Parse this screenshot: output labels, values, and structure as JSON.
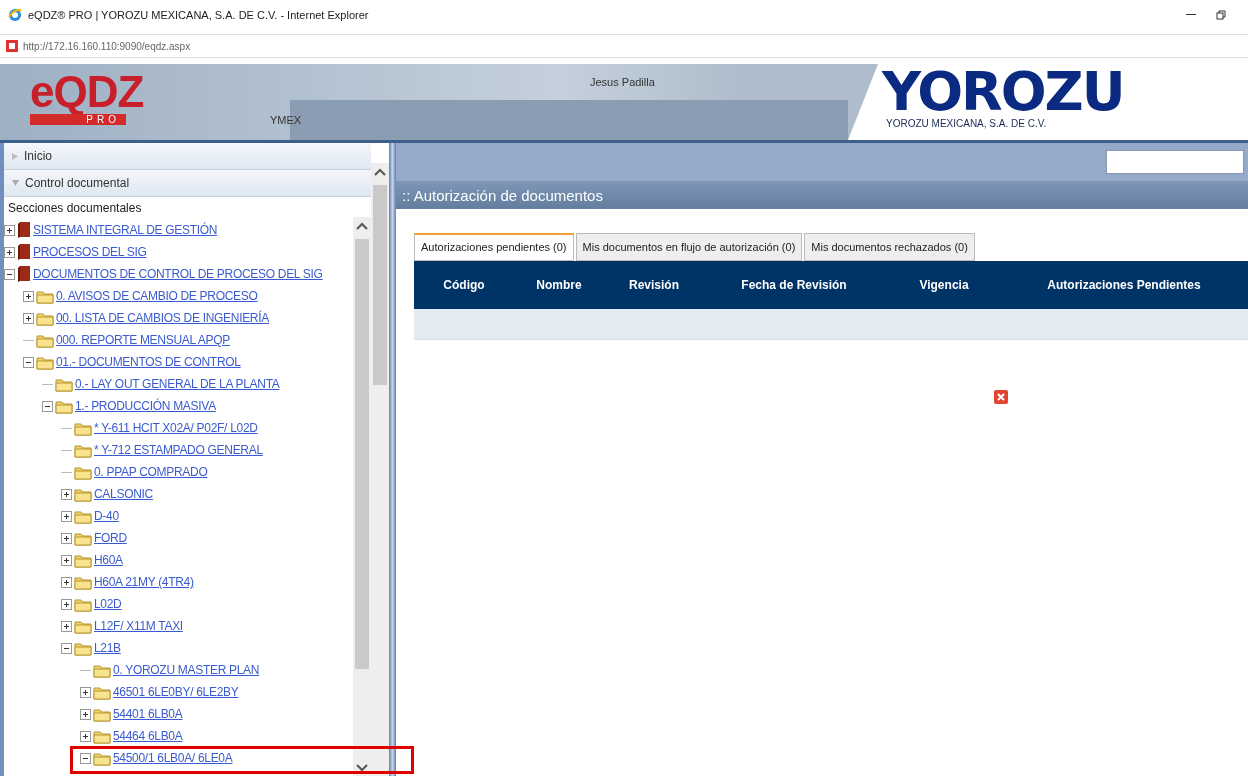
{
  "window": {
    "title": "eQDZ® PRO | YOROZU MEXICANA, S.A. DE C.V. - Internet Explorer",
    "url": "http://172.16.160.110:9090/eqdz.aspx"
  },
  "header": {
    "logo": "eQDZ",
    "logo_sub": "PRO",
    "plant": "YMEX",
    "user": "Jesus Padilla",
    "brand": "YOROZU",
    "brand_sub": "YOROZU MEXICANA, S.A. DE C.V."
  },
  "sidebar": {
    "sections": [
      {
        "label": "Inicio",
        "expanded": false
      },
      {
        "label": "Control documental",
        "expanded": true
      }
    ],
    "subtitle": "Secciones documentales",
    "tree": [
      {
        "label": "SISTEMA INTEGRAL DE GESTIÓN",
        "kind": "book",
        "expanded": false
      },
      {
        "label": "PROCESOS DEL SIG",
        "kind": "book",
        "expanded": false
      },
      {
        "label": "DOCUMENTOS DE CONTROL DE PROCESO DEL SIG",
        "kind": "book",
        "expanded": true,
        "children": [
          {
            "label": "0. AVISOS DE CAMBIO DE PROCESO",
            "kind": "folder",
            "expanded": false
          },
          {
            "label": "00. LISTA DE CAMBIOS DE INGENIERÍA",
            "kind": "folder",
            "expanded": false
          },
          {
            "label": "000. REPORTE MENSUAL APQP",
            "kind": "folder"
          },
          {
            "label": "01.- DOCUMENTOS DE CONTROL",
            "kind": "folder",
            "expanded": true,
            "children": [
              {
                "label": "0.- LAY OUT GENERAL DE LA PLANTA",
                "kind": "folder"
              },
              {
                "label": "1.- PRODUCCIÓN MASIVA",
                "kind": "folder",
                "expanded": true,
                "children": [
                  {
                    "label": "* Y-611 HCIT X02A/ P02F/ L02D",
                    "kind": "folder"
                  },
                  {
                    "label": "* Y-712 ESTAMPADO GENERAL",
                    "kind": "folder"
                  },
                  {
                    "label": "0. PPAP COMPRADO",
                    "kind": "folder"
                  },
                  {
                    "label": "CALSONIC",
                    "kind": "folder",
                    "expanded": false
                  },
                  {
                    "label": "D-40",
                    "kind": "folder",
                    "expanded": false
                  },
                  {
                    "label": "FORD",
                    "kind": "folder",
                    "expanded": false
                  },
                  {
                    "label": "H60A",
                    "kind": "folder",
                    "expanded": false
                  },
                  {
                    "label": "H60A 21MY (4TR4)",
                    "kind": "folder",
                    "expanded": false
                  },
                  {
                    "label": "L02D",
                    "kind": "folder",
                    "expanded": false
                  },
                  {
                    "label": "L12F/ X11M TAXI",
                    "kind": "folder",
                    "expanded": false
                  },
                  {
                    "label": "L21B",
                    "kind": "folder",
                    "expanded": true,
                    "children": [
                      {
                        "label": "0. YOROZU MASTER PLAN",
                        "kind": "folder"
                      },
                      {
                        "label": "46501 6LE0BY/ 6LE2BY",
                        "kind": "folder",
                        "expanded": false
                      },
                      {
                        "label": "54401 6LB0A",
                        "kind": "folder",
                        "expanded": false
                      },
                      {
                        "label": "54464 6LB0A",
                        "kind": "folder",
                        "expanded": false
                      },
                      {
                        "label": "54500/1 6LB0A/ 6LE0A",
                        "kind": "folder",
                        "expanded": true,
                        "highlighted": true
                      }
                    ]
                  }
                ]
              }
            ]
          }
        ]
      }
    ]
  },
  "content": {
    "title": ":: Autorización de documentos",
    "tabs": [
      {
        "label": "Autorizaciones pendientes (0)",
        "selected": true
      },
      {
        "label": "Mis documentos en flujo de autorización (0)",
        "selected": false
      },
      {
        "label": "Mis documentos rechazados (0)",
        "selected": false
      }
    ],
    "table": {
      "columns": [
        "Código",
        "Nombre",
        "Revisión",
        "Fecha de Revisión",
        "Vigencia",
        "Autorizaciones Pendientes"
      ]
    }
  }
}
